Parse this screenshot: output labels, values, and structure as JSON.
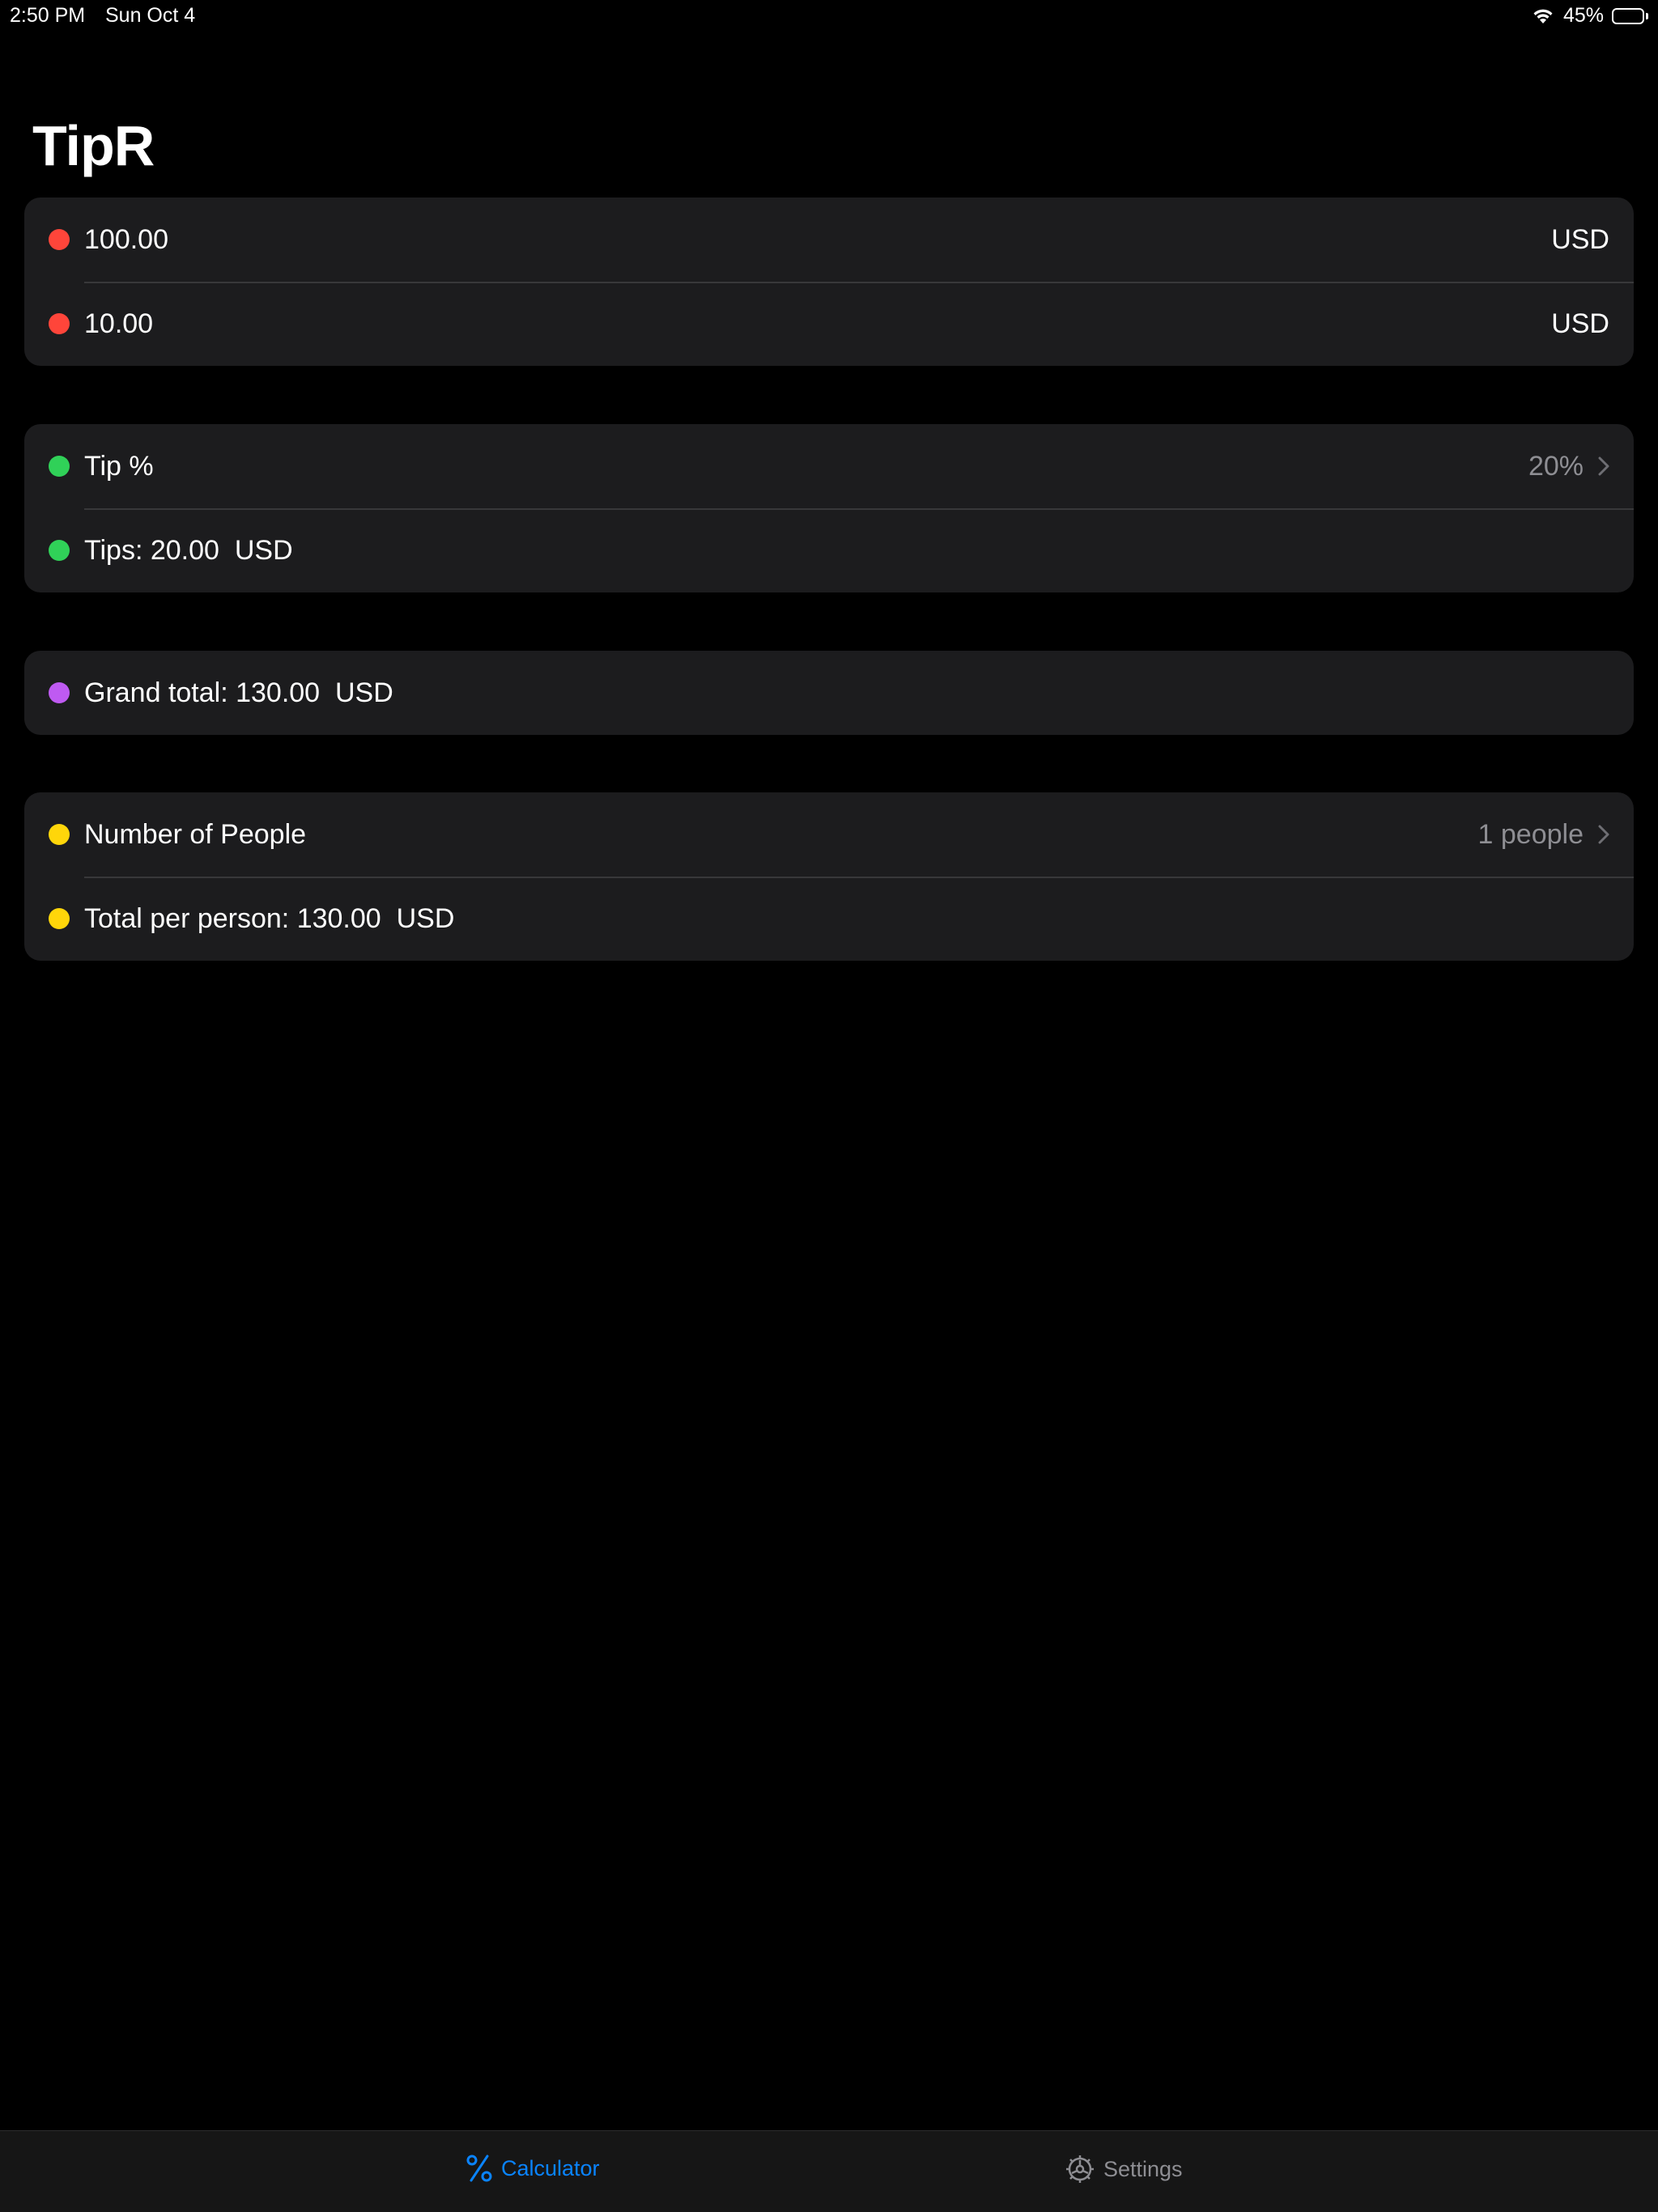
{
  "status_bar": {
    "time": "2:50 PM",
    "date": "Sun Oct 4",
    "battery": "45%",
    "battery_level": 0.45
  },
  "title": "TipR",
  "colors": {
    "red": "#ff453a",
    "green": "#30d158",
    "purple": "#bf5af2",
    "yellow": "#ffd60a",
    "accent": "#0a84ff",
    "inactive": "#8e8e93"
  },
  "bill_group": {
    "bill_amount": {
      "value": "100.00",
      "currency": "USD"
    },
    "extra_amount": {
      "value": "10.00",
      "currency": "USD"
    }
  },
  "tip_group": {
    "tip_label": "Tip %",
    "tip_value": "20%",
    "tips_text": "Tips: 20.00  USD"
  },
  "total_group": {
    "grand_total_text": "Grand total: 130.00  USD"
  },
  "people_group": {
    "people_label": "Number of People",
    "people_value": "1 people",
    "per_person_text": "Total per person: 130.00  USD"
  },
  "tab_bar": {
    "tabs": [
      {
        "label": "Calculator",
        "icon": "percent-icon",
        "active": true
      },
      {
        "label": "Settings",
        "icon": "gear-icon",
        "active": false
      }
    ]
  }
}
